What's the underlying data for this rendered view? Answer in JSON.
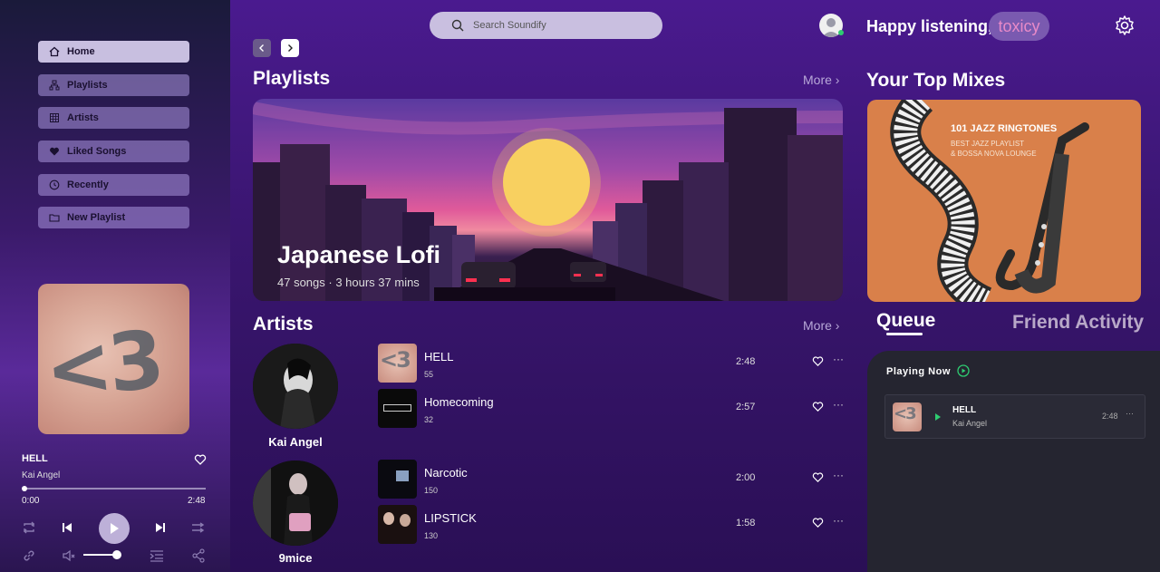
{
  "sidebar": {
    "items": [
      {
        "label": "Home",
        "icon": "home-icon"
      },
      {
        "label": "Playlists",
        "icon": "playlists-icon"
      },
      {
        "label": "Artists",
        "icon": "artists-icon"
      },
      {
        "label": "Liked Songs",
        "icon": "heart-icon"
      },
      {
        "label": "Recently",
        "icon": "clock-icon"
      },
      {
        "label": "New Playlist",
        "icon": "folder-icon"
      }
    ]
  },
  "now_playing": {
    "title": "HELL",
    "artist": "Kai Angel",
    "current_time": "0:00",
    "total_time": "2:48",
    "progress": 0.01,
    "volume": 0.85
  },
  "search": {
    "placeholder": "Search Soundify"
  },
  "main": {
    "playlists_title": "Playlists",
    "artists_title": "Artists",
    "more_label": "More",
    "featured": {
      "title": "Japanese Lofi",
      "subtitle": "47 songs · 3 hours 37 mins"
    }
  },
  "artists": [
    {
      "name": "Kai Angel",
      "songs": [
        {
          "title": "HELL",
          "plays": "55",
          "duration": "2:48"
        },
        {
          "title": "Homecoming",
          "plays": "32",
          "duration": "2:57"
        }
      ]
    },
    {
      "name": "9mice",
      "songs": [
        {
          "title": "Narcotic",
          "plays": "150",
          "duration": "2:00"
        },
        {
          "title": "LIPSTICK",
          "plays": "130",
          "duration": "1:58"
        }
      ]
    }
  ],
  "header": {
    "greeting": "Happy listening,",
    "username": "toxicy"
  },
  "right": {
    "mixes_title": "Your Top Mixes",
    "mix_cover": {
      "heading": "101 JAZZ RINGTONES",
      "line1": "BEST JAZZ PLAYLIST",
      "line2": "& BOSSA NOVA LOUNGE"
    },
    "tabs": [
      "Queue",
      "Friend Activity"
    ],
    "playing_now_label": "Playing Now",
    "queue": [
      {
        "title": "HELL",
        "artist": "Kai Angel",
        "duration": "2:48"
      }
    ]
  },
  "colors": {
    "accent_pill": "#7a5ab0",
    "username_text": "#e88ac8",
    "online": "#2ecc71",
    "queue_bg": "#252530"
  }
}
